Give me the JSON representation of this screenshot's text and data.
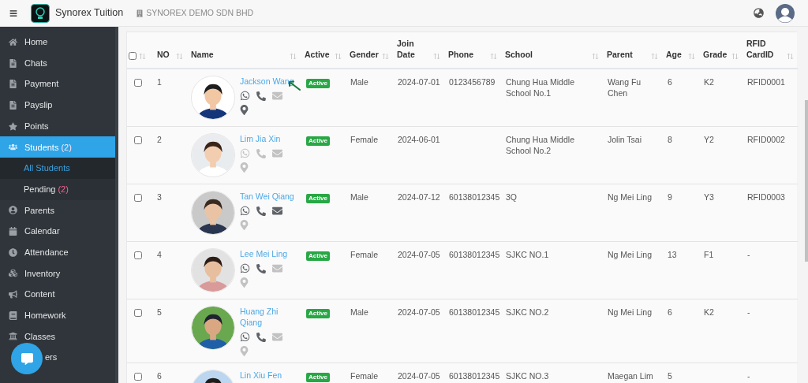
{
  "header": {
    "app_name": "Synorex Tuition",
    "company": "SYNOREX DEMO SDN BHD"
  },
  "sidebar": {
    "items": [
      {
        "label": "Home",
        "selected": false
      },
      {
        "label": "Chats",
        "selected": false
      },
      {
        "label": "Payment",
        "selected": false
      },
      {
        "label": "Payslip",
        "selected": false
      },
      {
        "label": "Points",
        "selected": false
      },
      {
        "label": "Students",
        "count": "(2)",
        "selected": true,
        "children": [
          {
            "label": "All Students",
            "selected": true
          },
          {
            "label": "Pending",
            "count": "(2)",
            "selected": false
          }
        ]
      },
      {
        "label": "Parents",
        "selected": false
      },
      {
        "label": "Calendar",
        "selected": false
      },
      {
        "label": "Attendance",
        "selected": false
      },
      {
        "label": "Inventory",
        "selected": false
      },
      {
        "label": "Content",
        "selected": false
      },
      {
        "label": "Homework",
        "selected": false
      },
      {
        "label": "Classes",
        "selected": false
      },
      {
        "label": "ers",
        "selected": false
      }
    ]
  },
  "table": {
    "select_all_checked": false,
    "columns": [
      "NO",
      "Name",
      "Active",
      "Gender",
      "Join Date",
      "Phone",
      "School",
      "Parent",
      "Age",
      "Grade",
      "RFID CardID"
    ],
    "rows": [
      {
        "checked": false,
        "no": "1",
        "name": "Jackson Wang",
        "status": "Active",
        "gender": "Male",
        "join_date": "2024-07-01",
        "phone": "0123456789",
        "school": "Chung Hua Middle School No.1",
        "parent": "Wang Fu Chen",
        "age": "6",
        "grade": "K2",
        "rfid": "RFID0001",
        "contact": {
          "whatsapp": true,
          "call": true,
          "email": false,
          "location": true
        }
      },
      {
        "checked": false,
        "no": "2",
        "name": "Lim Jia Xin",
        "status": "Active",
        "gender": "Female",
        "join_date": "2024-06-01",
        "school": "Chung Hua Middle School No.2",
        "parent": "Jolin Tsai",
        "age": "8",
        "grade": "Y2",
        "rfid": "RFID0002",
        "contact": {
          "whatsapp": false,
          "call": false,
          "email": false,
          "location": false
        }
      },
      {
        "checked": false,
        "no": "3",
        "name": "Tan Wei Qiang",
        "status": "Active",
        "gender": "Male",
        "join_date": "2024-07-12",
        "phone": "60138012345",
        "school": "3Q",
        "parent": "Ng Mei Ling",
        "age": "9",
        "grade": "Y3",
        "rfid": "RFID0003",
        "contact": {
          "whatsapp": true,
          "call": true,
          "email": true,
          "location": false
        }
      },
      {
        "checked": false,
        "no": "4",
        "name": "Lee Mei Ling",
        "status": "Active",
        "gender": "Female",
        "join_date": "2024-07-05",
        "phone": "60138012345",
        "school": "SJKC NO.1",
        "parent": "Ng Mei Ling",
        "age": "13",
        "grade": "F1",
        "rfid": "-",
        "contact": {
          "whatsapp": true,
          "call": true,
          "email": false,
          "location": false
        }
      },
      {
        "checked": false,
        "no": "5",
        "name": "Huang Zhi Qiang",
        "status": "Active",
        "gender": "Male",
        "join_date": "2024-07-05",
        "phone": "60138012345",
        "school": "SJKC NO.2",
        "parent": "Ng Mei Ling",
        "age": "6",
        "grade": "K2",
        "rfid": "-",
        "contact": {
          "whatsapp": true,
          "call": true,
          "email": false,
          "location": false
        }
      },
      {
        "checked": false,
        "no": "6",
        "name": "Lin Xiu Fen",
        "status": "Active",
        "gender": "Female",
        "join_date": "2024-07-05",
        "phone": "60138012345",
        "school": "SJKC NO.3",
        "parent": "Maegan Lim",
        "age": "5",
        "rfid": "-"
      }
    ]
  }
}
